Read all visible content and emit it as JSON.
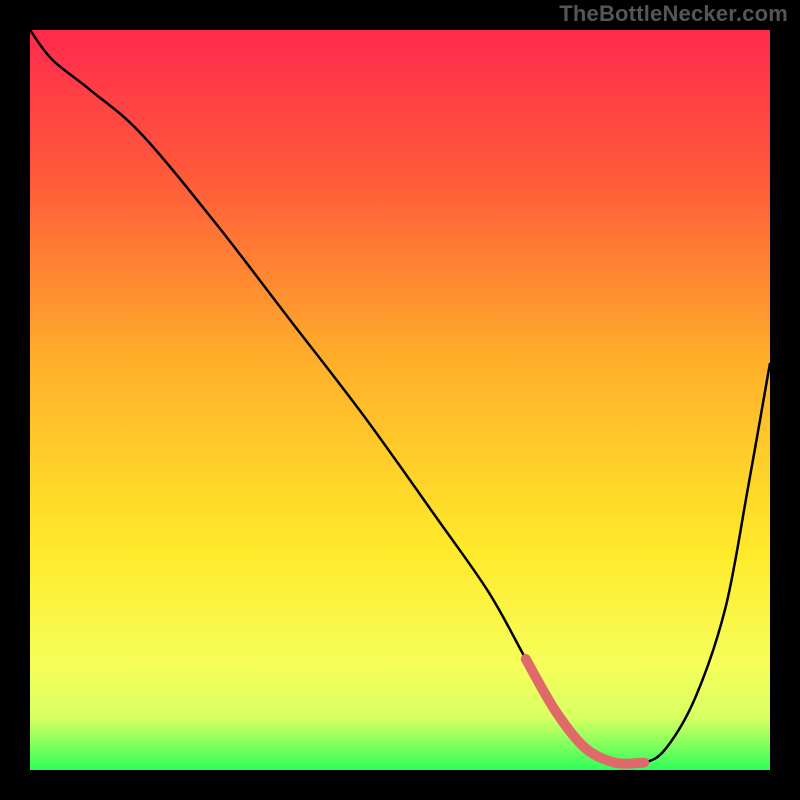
{
  "watermark": "TheBottleNecker.com",
  "chart_data": {
    "type": "line",
    "title": "",
    "xlabel": "",
    "ylabel": "",
    "xlim": [
      0,
      100
    ],
    "ylim": [
      0,
      100
    ],
    "gradient_stops": [
      {
        "offset": 0,
        "color": "#ff2a4d"
      },
      {
        "offset": 20,
        "color": "#ff5a3a"
      },
      {
        "offset": 45,
        "color": "#ffb02a"
      },
      {
        "offset": 70,
        "color": "#ffe92a"
      },
      {
        "offset": 86,
        "color": "#f6ff5a"
      },
      {
        "offset": 93,
        "color": "#d7ff62"
      },
      {
        "offset": 100,
        "color": "#2eff5a"
      }
    ],
    "series": [
      {
        "name": "bottleneck-curve",
        "x": [
          0,
          3,
          8,
          15,
          25,
          35,
          45,
          55,
          62,
          67,
          71,
          75,
          79,
          83,
          86,
          90,
          94,
          97,
          100
        ],
        "values": [
          100,
          96,
          92,
          86,
          74,
          61,
          48,
          34,
          24,
          15,
          8,
          3,
          1,
          1,
          3,
          10,
          22,
          38,
          55
        ]
      }
    ],
    "highlight": {
      "name": "optimal-range",
      "color": "#e06a6a",
      "x": [
        67,
        71,
        75,
        79,
        83
      ],
      "values": [
        15,
        8,
        3,
        1,
        1
      ]
    }
  }
}
